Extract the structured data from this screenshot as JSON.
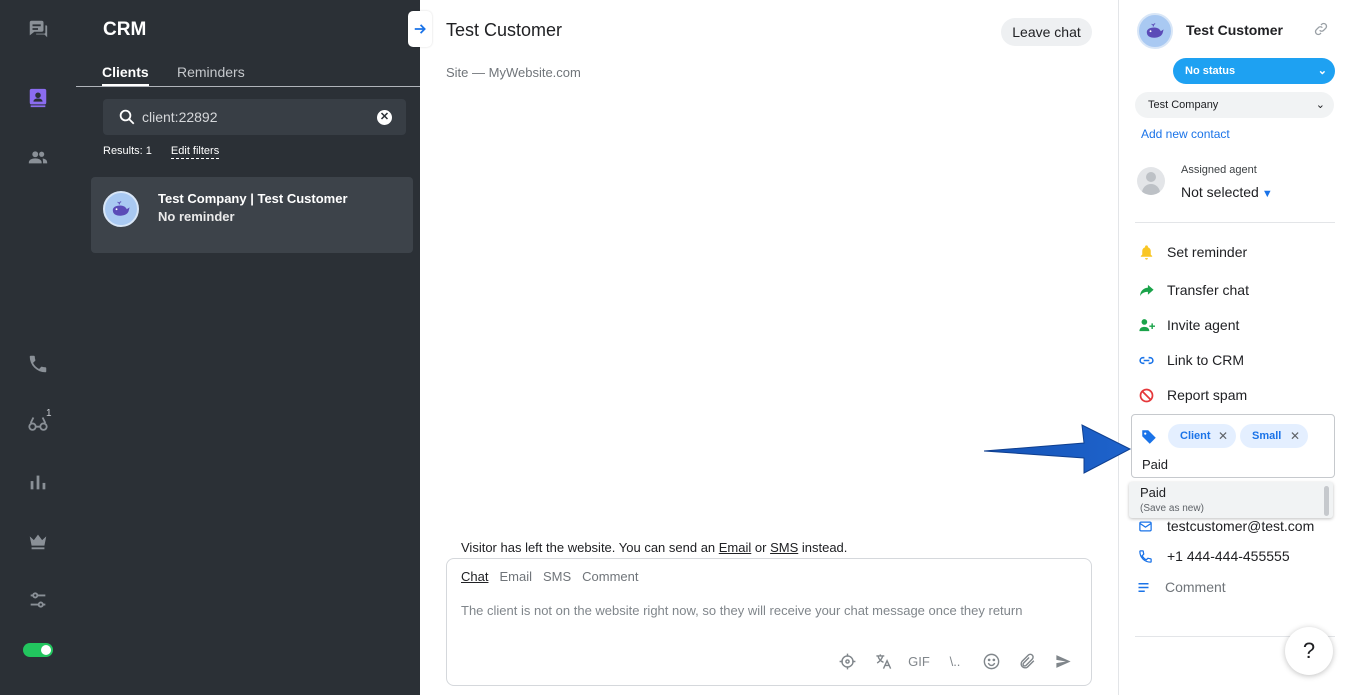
{
  "rail": {
    "icons": [
      "chats-icon",
      "crm-icon",
      "contacts-icon",
      "phone-icon",
      "visitors-icon",
      "analytics-icon",
      "crown-icon",
      "settings-sliders-icon"
    ],
    "visitors_badge": "1",
    "online_toggle": true
  },
  "crm": {
    "title": "CRM",
    "tabs": [
      {
        "label": "Clients",
        "active": true
      },
      {
        "label": "Reminders",
        "active": false
      }
    ],
    "search_value": "client:22892",
    "results_label": "Results: 1",
    "edit_filters_label": "Edit filters",
    "client_card": {
      "name": "Test Company | Test Customer",
      "reminder": "No reminder"
    }
  },
  "chat": {
    "title": "Test Customer",
    "leave_label": "Leave chat",
    "site_label": "Site — MyWebsite.com",
    "visitor_note": {
      "prefix": "Visitor has left the website. You can send an ",
      "email": "Email",
      "or": " or ",
      "sms": "SMS",
      "suffix": " instead."
    },
    "composer": {
      "tabs": [
        {
          "label": "Chat",
          "active": true
        },
        {
          "label": "Email",
          "active": false
        },
        {
          "label": "SMS",
          "active": false
        },
        {
          "label": "Comment",
          "active": false
        }
      ],
      "placeholder": "The client is not on the website right now, so they will receive your chat message once they return",
      "tools": [
        "target-icon",
        "translate-icon",
        "gif-icon",
        "shortcuts-icon",
        "emoji-icon",
        "attach-icon",
        "send-icon"
      ],
      "gif_label": "GIF",
      "shortcuts_label": "\\.."
    }
  },
  "side": {
    "customer_name": "Test Customer",
    "status_label": "No status",
    "company_label": "Test Company",
    "add_contact_label": "Add new contact",
    "assigned_label": "Assigned agent",
    "assigned_value": "Not selected",
    "actions": [
      {
        "label": "Set reminder",
        "icon": "bell-icon",
        "color": "#f9c623"
      },
      {
        "label": "Transfer chat",
        "icon": "transfer-icon",
        "color": "#1aa34a"
      },
      {
        "label": "Invite agent",
        "icon": "invite-agent-icon",
        "color": "#1aa34a"
      },
      {
        "label": "Link to CRM",
        "icon": "link-icon",
        "color": "#1a73e8"
      },
      {
        "label": "Report spam",
        "icon": "spam-icon",
        "color": "#e5383b"
      }
    ],
    "tags": [
      "Client",
      "Small"
    ],
    "tag_input_value": "Paid",
    "suggestion": {
      "value": "Paid",
      "hint": "(Save as new)"
    },
    "email": "testcustomer@test.com",
    "phone": "+1 444-444-455555",
    "comment_label": "Comment",
    "help_label": "?"
  },
  "colors": {
    "rail_bg": "#2b3036",
    "accent": "#1a73e8",
    "status_bg": "#1ea1f2",
    "arrow": "#1553b6"
  }
}
